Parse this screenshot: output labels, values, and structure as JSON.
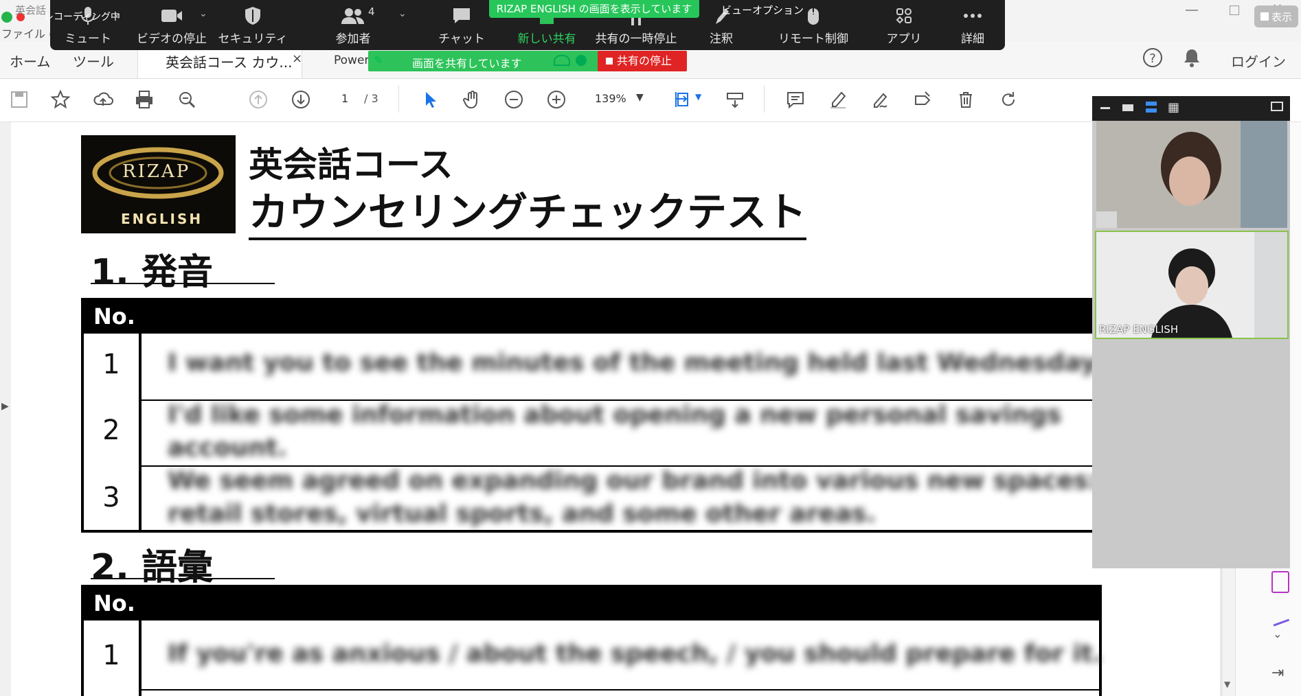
{
  "titlebar": {
    "recording_label": "レコーディング中",
    "file_menu": "ファイル (F)",
    "app_title_fragment": "英会話",
    "display_button": "表示"
  },
  "tabs": {
    "home": "ホーム",
    "tools": "ツール",
    "document_tab": "英会話コース カウ...",
    "document_tab_close": "×",
    "power_tab": "Power"
  },
  "login": "ログイン",
  "toolbar": {
    "page_current": "1",
    "page_total": "/ 3",
    "zoom_value": "139%"
  },
  "zoom": {
    "banner": "RIZAP ENGLISH の画面を表示しています",
    "view_options": "ビューオプション",
    "buttons": {
      "mute": "ミュート",
      "stop_video": "ビデオの停止",
      "security": "セキュリティ",
      "participants": "参加者",
      "participants_count": "4",
      "chat": "チャット",
      "new_share": "新しい共有",
      "pause_share": "共有の一時停止",
      "annotate": "注釈",
      "remote_control": "リモート制御",
      "apps": "アプリ",
      "more": "詳細"
    },
    "share_status": "画面を共有しています",
    "stop_share": "共有の停止",
    "participant_name": "RIZAP ENGLISH"
  },
  "document": {
    "logo_top": "RIZAP",
    "logo_bottom": "ENGLISH",
    "title_line1": "英会話コース",
    "title_line2": "カウンセリングチェックテスト",
    "section1": "1.  発音",
    "section2": "2.  語彙",
    "table_header": "No.",
    "pron_rows": [
      {
        "no": "1",
        "text": "I want you to see the minutes of the meeting held last Wednesday."
      },
      {
        "no": "2",
        "text": "I'd like some information about opening a new personal savings",
        "text2": "account."
      },
      {
        "no": "3",
        "text": "We seem agreed on expanding our brand into various new spaces:",
        "text2": "retail stores, virtual sports, and some other areas."
      }
    ],
    "vocab_rows": [
      {
        "no": "1",
        "text": "If you're as anxious / about the speech, / you should prepare for it."
      }
    ]
  }
}
